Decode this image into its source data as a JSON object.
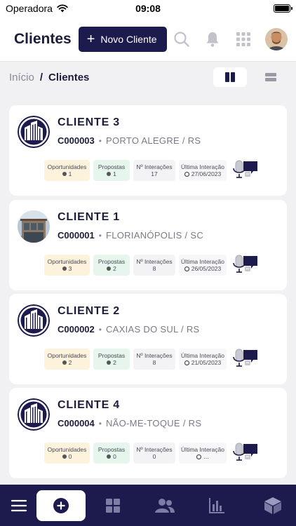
{
  "status_bar": {
    "carrier": "Operadora",
    "time": "09:08"
  },
  "header": {
    "title": "Clientes",
    "new_button_label": "Novo Cliente"
  },
  "breadcrumb": {
    "home": "Início",
    "separator": "/",
    "current": "Clientes"
  },
  "stat_labels": {
    "opportunities": "Oportunidades",
    "proposals": "Propostas",
    "interactions": "Nº Interações",
    "last_interaction": "Última Interação"
  },
  "clients": [
    {
      "name": "CLIENTE 3",
      "code": "C000003",
      "city": "PORTO ALEGRE / RS",
      "opportunities": "1",
      "proposals": "1",
      "interactions": "17",
      "last_interaction": "27/06/2023",
      "logo": "building-logo"
    },
    {
      "name": "CLIENTE 1",
      "code": "C000001",
      "city": "FLORIANÓPOLIS / SC",
      "opportunities": "3",
      "proposals": "2",
      "interactions": "8",
      "last_interaction": "26/05/2023",
      "logo": "storefront-photo"
    },
    {
      "name": "CLIENTE 2",
      "code": "C000002",
      "city": "CAXIAS DO SUL / RS",
      "opportunities": "2",
      "proposals": "2",
      "interactions": "8",
      "last_interaction": "21/05/2023",
      "logo": "building-logo"
    },
    {
      "name": "CLIENTE 4",
      "code": "C000004",
      "city": "NÃO-ME-TOQUE / RS",
      "opportunities": "0",
      "proposals": "0",
      "interactions": "0",
      "last_interaction": "...",
      "logo": "building-logo"
    }
  ],
  "colors": {
    "brand_navy": "#1d1b4d",
    "opportunities_bg": "#fdf3dc",
    "proposals_bg": "#e6f6ec",
    "page_bg": "#f1f1f4"
  },
  "nav_icons": [
    "menu-icon",
    "add-icon",
    "dashboard-icon",
    "users-icon",
    "chart-icon",
    "box-icon"
  ]
}
